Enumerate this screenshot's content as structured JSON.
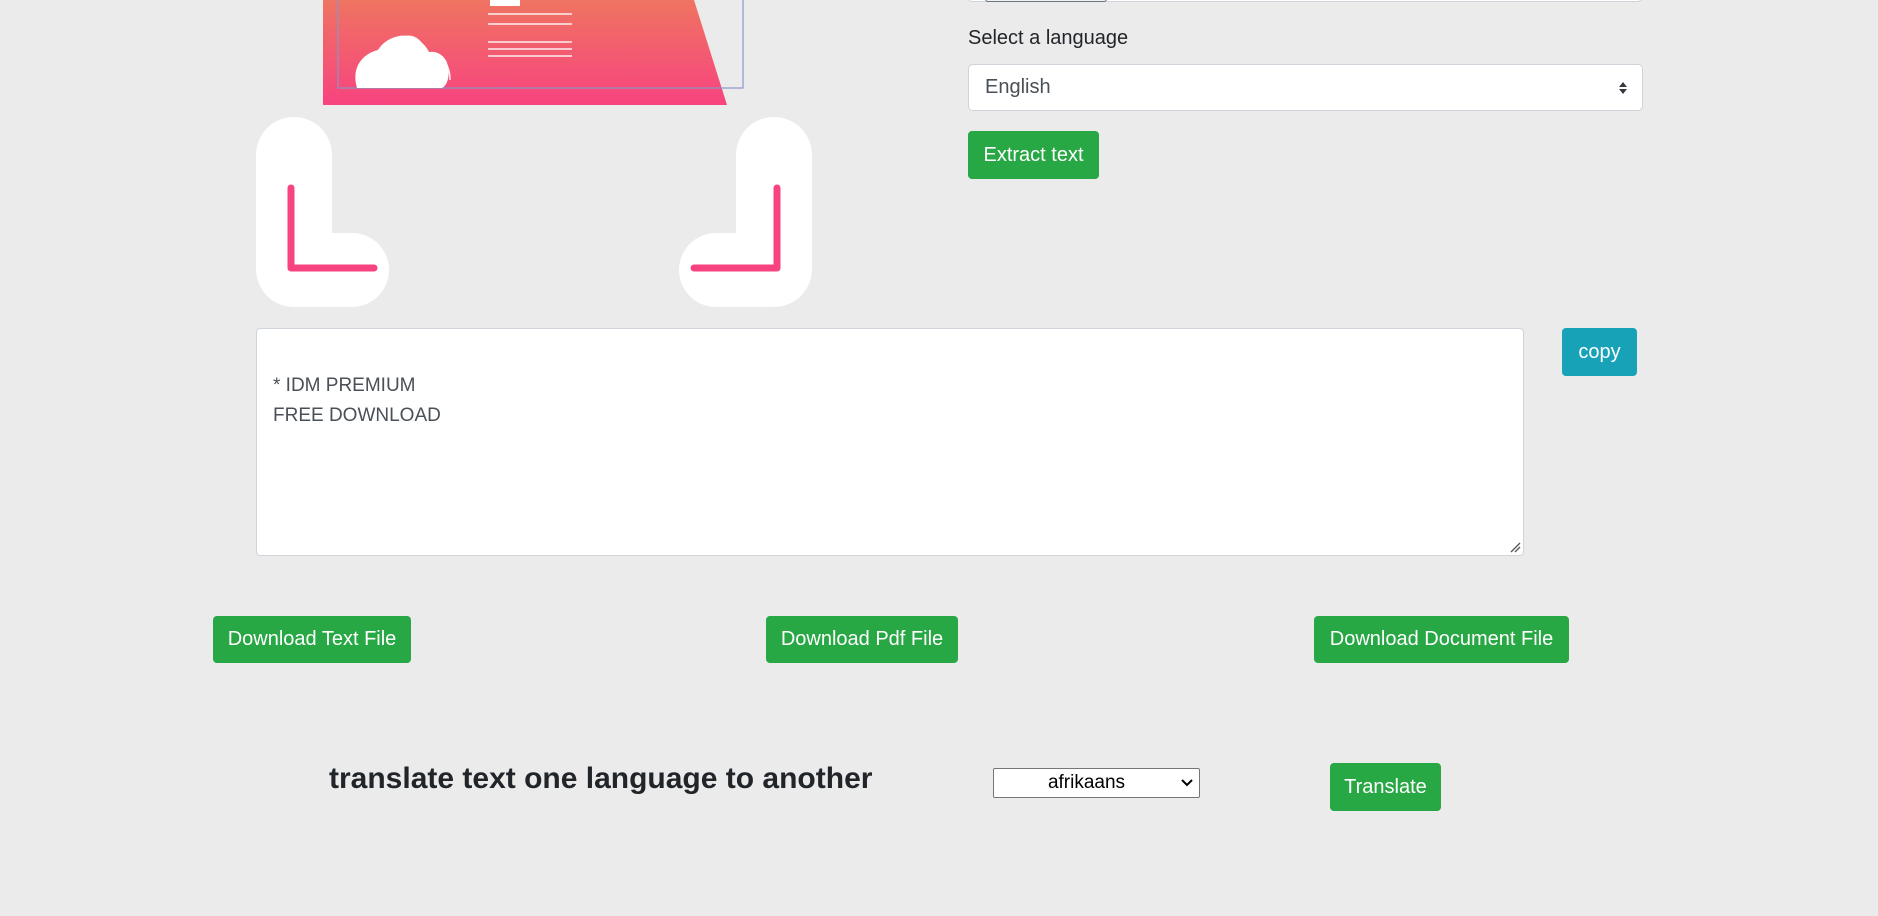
{
  "ocr": {
    "language_label": "Select a language",
    "language_select": {
      "selected": "English"
    },
    "extract_button": "Extract text",
    "result_text": "* IDM PREMIUM\nFREE DOWNLOAD",
    "copy_button": "copy"
  },
  "downloads": {
    "text_file": "Download Text File",
    "pdf_file": "Download Pdf File",
    "document_file": "Download Document File"
  },
  "translate": {
    "title": "translate text one language to another",
    "target_select": {
      "selected": "afrikaans"
    },
    "button": "Translate"
  },
  "colors": {
    "background": "#ebebeb",
    "success": "#28a745",
    "info": "#17a2b8",
    "illustration_pink": "#f7437f",
    "illustration_orange": "#ef7461"
  },
  "icons": {
    "select_caret": "up-down-caret-icon",
    "translate_select_chevron": "chevron-down-icon",
    "textarea_resize": "resize-grip-icon",
    "scanner_corner_left": "scan-corner-bottom-left-icon",
    "scanner_corner_right": "scan-corner-bottom-right-icon"
  }
}
